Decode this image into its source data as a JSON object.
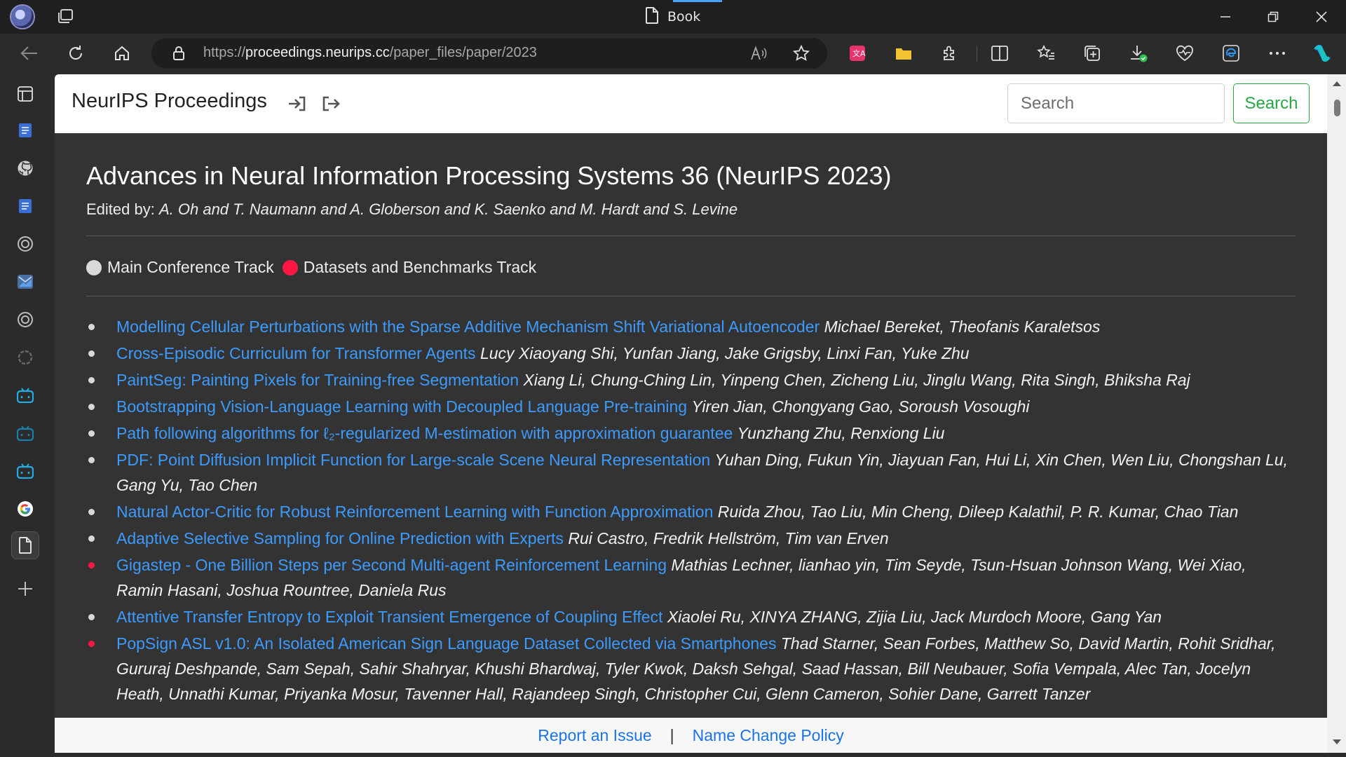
{
  "window": {
    "tab_title": "Book"
  },
  "toolbar": {
    "url_prefix": "https://",
    "url_domain": "proceedings.neurips.cc",
    "url_path": "/paper_files/paper/2023"
  },
  "site": {
    "brand": "NeurIPS Proceedings",
    "search_placeholder": "Search",
    "search_button": "Search"
  },
  "page": {
    "title": "Advances in Neural Information Processing Systems 36 (NeurIPS 2023)",
    "edited_label": "Edited by:",
    "editors": "A. Oh and T. Naumann and A. Globerson and K. Saenko and M. Hardt and S. Levine",
    "legend": [
      {
        "label": "Main Conference Track",
        "color": "#d9d9d9"
      },
      {
        "label": "Datasets and Benchmarks Track",
        "color": "#ff1744"
      }
    ]
  },
  "papers": [
    {
      "title": "Modelling Cellular Perturbations with the Sparse Additive Mechanism Shift Variational Autoencoder",
      "authors": "Michael Bereket, Theofanis Karaletsos",
      "track": "main"
    },
    {
      "title": "Cross-Episodic Curriculum for Transformer Agents",
      "authors": "Lucy Xiaoyang Shi, Yunfan Jiang, Jake Grigsby, Linxi Fan, Yuke Zhu",
      "track": "main"
    },
    {
      "title": "PaintSeg: Painting Pixels for Training-free Segmentation",
      "authors": "Xiang Li, Chung-Ching Lin, Yinpeng Chen, Zicheng Liu, Jinglu Wang, Rita Singh, Bhiksha Raj",
      "track": "main"
    },
    {
      "title": "Bootstrapping Vision-Language Learning with Decoupled Language Pre-training",
      "authors": "Yiren Jian, Chongyang Gao, Soroush Vosoughi",
      "track": "main"
    },
    {
      "title": "Path following algorithms for ℓ₂-regularized M-estimation with approximation guarantee",
      "authors": "Yunzhang Zhu, Renxiong Liu",
      "track": "main"
    },
    {
      "title": "PDF: Point Diffusion Implicit Function for Large-scale Scene Neural Representation",
      "authors": "Yuhan Ding, Fukun Yin, Jiayuan Fan, Hui Li, Xin Chen, Wen Liu, Chongshan Lu, Gang Yu, Tao Chen",
      "track": "main"
    },
    {
      "title": "Natural Actor-Critic for Robust Reinforcement Learning with Function Approximation",
      "authors": "Ruida Zhou, Tao Liu, Min Cheng, Dileep Kalathil, P. R. Kumar, Chao Tian",
      "track": "main"
    },
    {
      "title": "Adaptive Selective Sampling for Online Prediction with Experts",
      "authors": "Rui Castro, Fredrik Hellström, Tim van Erven",
      "track": "main"
    },
    {
      "title": "Gigastep - One Billion Steps per Second Multi-agent Reinforcement Learning",
      "authors": "Mathias Lechner, lianhao yin, Tim Seyde, Tsun-Hsuan Johnson Wang, Wei Xiao, Ramin Hasani, Joshua Rountree, Daniela Rus",
      "track": "datasets"
    },
    {
      "title": "Attentive Transfer Entropy to Exploit Transient Emergence of Coupling Effect",
      "authors": "Xiaolei Ru, XINYA ZHANG, Zijia Liu, Jack Murdoch Moore, Gang Yan",
      "track": "main"
    },
    {
      "title": "PopSign ASL v1.0: An Isolated American Sign Language Dataset Collected via Smartphones",
      "authors": "Thad Starner, Sean Forbes, Matthew So, David Martin, Rohit Sridhar, Gururaj Deshpande, Sam Sepah, Sahir Shahryar, Khushi Bhardwaj, Tyler Kwok, Daksh Sehgal, Saad Hassan, Bill Neubauer, Sofia Vempala, Alec Tan, Jocelyn Heath, Unnathi Kumar, Priyanka Mosur, Tavenner Hall, Rajandeep Singh, Christopher Cui, Glenn Cameron, Sohier Dane, Garrett Tanzer",
      "track": "datasets"
    }
  ],
  "footer": {
    "report_link": "Report an Issue",
    "separator": "|",
    "name_change_link": "Name Change Policy"
  },
  "colors": {
    "link": "#3d9bff",
    "main_track": "#d9d9d9",
    "datasets_track": "#ff1744",
    "search_green": "#28a745"
  }
}
